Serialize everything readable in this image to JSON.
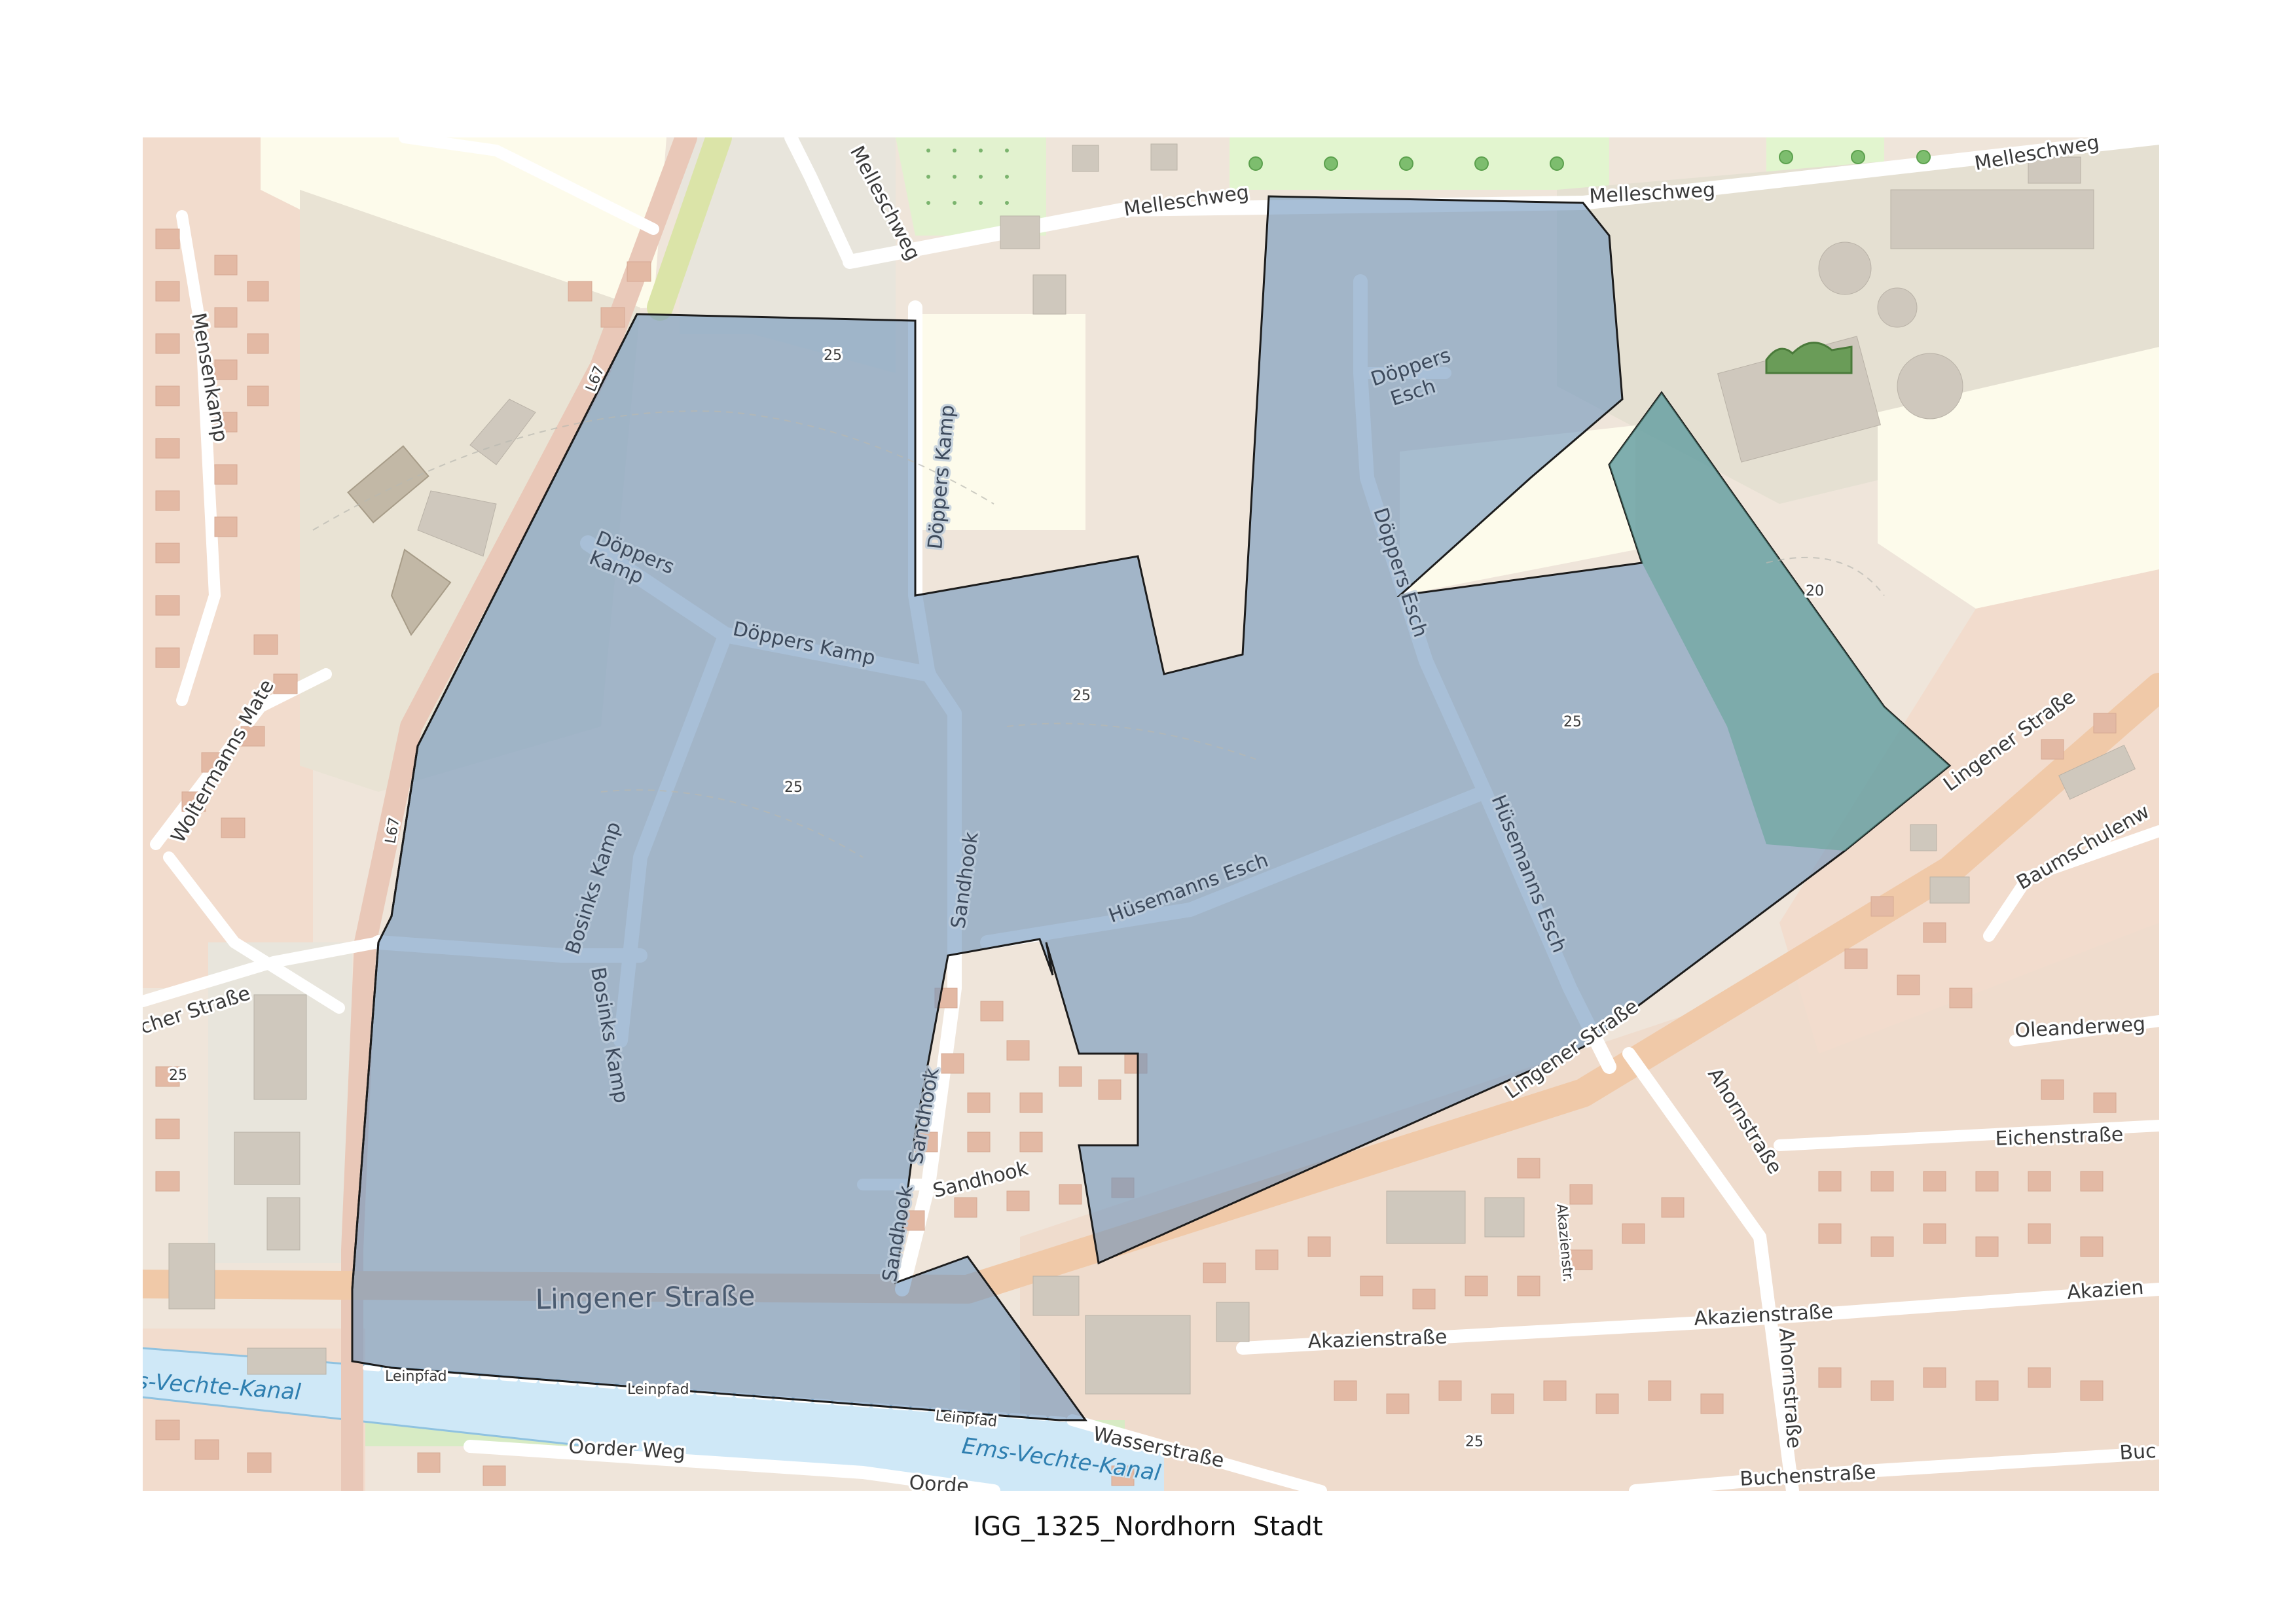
{
  "caption": "IGG_1325_Nordhorn  Stadt",
  "colors": {
    "residential": "#f2dccd",
    "industrial": "#e7dfd0",
    "farmland": "#fdfbeb",
    "park": "#e2f5cf",
    "water": "#cfe8f7",
    "road": "#ffffff",
    "main_road": "#f0c9a8",
    "highlight_fill": "#6e95bc",
    "highlight_green": "#5fa394",
    "building": "#e0b8a3",
    "industrial_building": "#c9c1b6"
  },
  "labels": {
    "melleschweg_1": "Melleschweg",
    "melleschweg_2": "Melleschweg",
    "melleschweg_3": "Melleschweg",
    "melleschweg_4": "Melleschweg",
    "doeppers_kamp_1": "Döppers Kamp",
    "doeppers_kamp_2": "Döppers",
    "doeppers_kamp_3": "Kamp",
    "doeppers_kamp_4": "Döppers Kamp",
    "doeppers_esch_1": "Döppers",
    "doeppers_esch_2": "Esch",
    "doeppers_esch_3": "Döppers Esch",
    "sandhook_1": "Sandhook",
    "sandhook_2": "Sandhook",
    "sandhook_3": "Sandhook",
    "sandhook_4": "Sandhook",
    "bosinks_kamp_1": "Bosinks Kamp",
    "bosinks_kamp_2": "Bosinks Kamp",
    "huesemanns_esch_1": "Hüsemanns Esch",
    "huesemanns_esch_2": "Hüsemanns Esch",
    "lingener_1": "Lingener Straße",
    "lingener_2": "Lingener Straße",
    "lingener_3": "Lingener Straße",
    "l67_1": "L67",
    "l67_2": "L67",
    "mensenkamp": "Mensenkamp",
    "woltermanns": "Woltermanns Mate",
    "cher_strasse": "cher Straße",
    "leinpfad_1": "Leinpfad",
    "leinpfad_2": "Leinpfad",
    "leinpfad_3": "Leinpfad",
    "kanal_1": "s-Vechte-Kanal",
    "kanal_2": "Ems-Vechte-Kanal",
    "oorder_1": "Oorder Weg",
    "oorder_2": "Oorde",
    "wasserstrasse": "Wasserstraße",
    "akazien_1": "Akazienstraße",
    "akazien_2": "Akazienstraße",
    "akazien_3": "Akazien",
    "akazienstr": "Akazienstr.",
    "ahorn_1": "Ahornstraße",
    "ahorn_2": "Ahornstraße",
    "eichen": "Eichenstraße",
    "oleander": "Oleanderweg",
    "baumschulen": "Baumschulenw",
    "buchen_1": "Buchenstraße",
    "buchen_2": "Buc",
    "contour_1": "25",
    "contour_2": "25",
    "contour_3": "25",
    "contour_4": "25",
    "contour_5": "25",
    "contour_6": "25",
    "contour_7": "20"
  }
}
